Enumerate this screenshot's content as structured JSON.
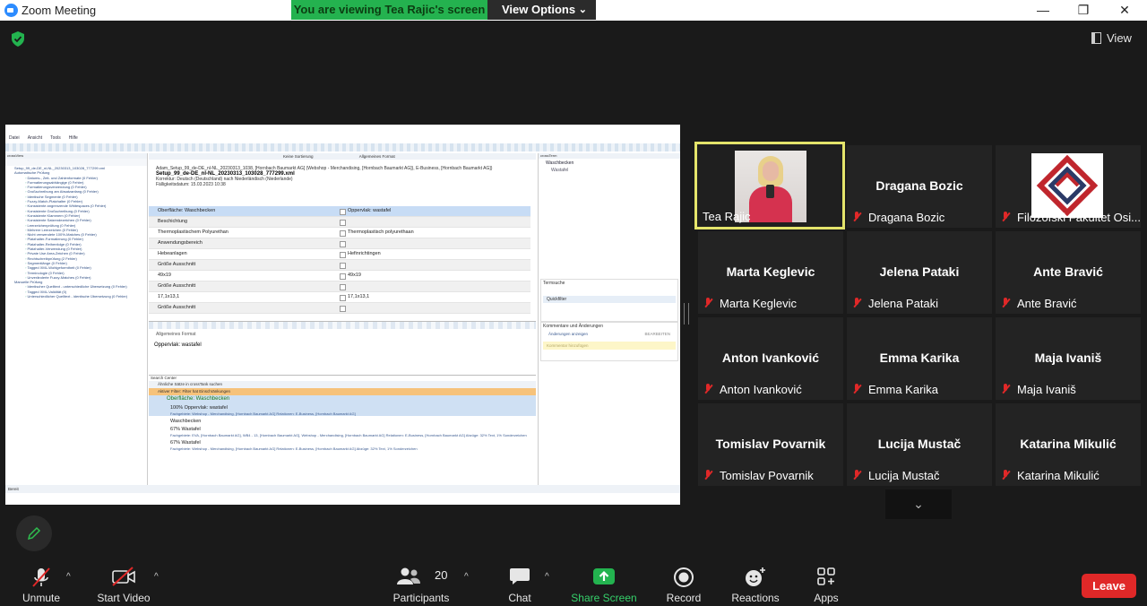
{
  "window": {
    "title": "Zoom Meeting",
    "share_banner": "You are viewing Tea Rajic's screen",
    "view_options": "View Options",
    "view_button": "View"
  },
  "shared_screen": {
    "menu": [
      "Datei",
      "Ansicht",
      "Tools",
      "Hilfe"
    ],
    "left_pane_title": "crossView",
    "tree": [
      "Setup_99_de-DE_nl-NL_20230313_103028_777299.xml",
      "Automatische Prüfung",
      "Datums-, Zeit- und Zahlenformate (0 Fehler)",
      "Formatierungsabhängige (0 Fehler)",
      "Formatierungsverwendung (0 Fehler)",
      "Großschreibung am Absatzanfang (0 Fehler)",
      "Identische Segmente (0 Fehler)",
      "Fuzzy-Match-Platzhalter (0 Fehler)",
      "Konsistente angrenzende Whitespaces (0 Fehler)",
      "Konsistente Großschreibung (0 Fehler)",
      "Konsistente Klammern (0 Fehler)",
      "Konsistente Satzendezeichen (0 Fehler)",
      "Leerzeichenprüfung (0 Fehler)",
      "Mehrere Leerzeichen (0 Fehler)",
      "Nicht verwendete 100%-Matches (0 Fehler)",
      "Platzhalter-Formatierung (0 Fehler)",
      "Platzhalter-Reihenfolge (0 Fehler)",
      "Platzhalter-Verwendung (0 Fehler)",
      "Private Use Area-Zeichen (0 Fehler)",
      "Rechtschreibprüfung (2 Fehler)",
      "Segmentlänge (0 Fehler)",
      "Tagged XML-Wohlgeformtheit (0 Fehler)",
      "Terminologie (0 Fehler)",
      "Unveränderte Fuzzy-Matches (0 Fehler)",
      "Manuelle Prüfung",
      "Identischer Quelltext - unterschiedliche Übersetzung (0 Fehler)",
      "Tagged XML-Validität (0)",
      "Unterschiedlicher Quelltext - identische Übersetzung (0 Fehler)"
    ],
    "sort_label": "Keine Sortierung",
    "format_label": "Allgemeines Format",
    "meta_line1": "Adam_Setup_99_de-DE_nl-NL_20230313_1038, [Hornbach Baumarkt AG] (Webshop - Merchandising, [Hornbach Baumarkt AG]), E-Business, [Hornbach Baumarkt AG])",
    "meta_file": "Setup_99_de-DE_nl-NL_20230313_103028_777299.xml",
    "meta_line3": "Korrektur: Deutsch (Deutschland) nach Niederländisch (Niederlande)",
    "meta_line4": "Fälligkeitsdatum: 15.03.2023 10:38",
    "segments": [
      {
        "src": "Oberfläche: Waschbecken",
        "tgt": "Oppervlak: wastafel"
      },
      {
        "src": "Beschichtung",
        "tgt": ""
      },
      {
        "src": "Thermoplastischem Polyurethan",
        "tgt": "Thermoplastisch polyurethaan"
      },
      {
        "src": "Anwendungsbereich",
        "tgt": ""
      },
      {
        "src": "Hebeanlagen",
        "tgt": "Hefinrichtingen"
      },
      {
        "src": "Größe Ausschnitt",
        "tgt": ""
      },
      {
        "src": "49x19",
        "tgt": "49x19"
      },
      {
        "src": "Größe Ausschnitt",
        "tgt": ""
      },
      {
        "src": "17,1x13,1",
        "tgt": "17,1x13,1"
      },
      {
        "src": "Größe Ausschnitt",
        "tgt": ""
      }
    ],
    "editor_format": "Allgemeines Format",
    "editor_text": "Oppervlak: wastafel",
    "search_title": "Search Center",
    "search_bar": "Ähnliche Sätze in crossTank suchen",
    "filter_text": "Aktiver Filter: Filter hat Einschränkungen",
    "search_term": "Oberfläche: Waschbecken",
    "hits": [
      {
        "pct": "100%",
        "text": "Oppervlak: wastafel",
        "meta": "Fachgebiete: Webshop - Merchandising, [Hornbach Baumarkt AG]   Relationen: E-Business, [Hornbach Baumarkt AG]"
      },
      {
        "pct": "",
        "text": "Waschbecken",
        "meta": ""
      },
      {
        "pct": "67%",
        "text": "Wastafel",
        "meta": "Fachgebiete: EVA, [Hornbach Baumarkt AG], WB4 - 13, [Hornbach Baumarkt AG], Webshop - Merchandising, [Hornbach Baumarkt AG]   Relationen: E-Business, [Hornbach Baumarkt AG]   Abzüge: 32% Text, 1% Sonderzeichen"
      },
      {
        "pct": "67%",
        "text": "Wastafel",
        "meta": "Fachgebiete: Webshop - Merchandising, [Hornbach Baumarkt AG]   Relationen: E-Business, [Hornbach Baumarkt AG]   Abzüge: 32% Text, 1% Sonderzeichen"
      }
    ],
    "right_pane_title": "crossTerm",
    "term_entries": [
      "Waschbecken",
      "Wastafel"
    ],
    "termsearch_title": "Termsuche",
    "quickfilter": "Quickfilter",
    "comments_title": "Kommentare und Änderungen",
    "changes_label": "Änderungen anzeigen",
    "edit_label": "BEARBEITEN",
    "comment_placeholder": "Kommentar hinzufügen",
    "status": "Bereit"
  },
  "participants": [
    {
      "display": "",
      "label": "Tea Rajic",
      "muted": false,
      "active": true,
      "video": "photo"
    },
    {
      "display": "Dragana Bozic",
      "label": "Dragana Bozic",
      "muted": true
    },
    {
      "display": "",
      "label": "Filozofski Fakultet Osi...",
      "muted": true,
      "video": "logo"
    },
    {
      "display": "Marta Keglevic",
      "label": "Marta Keglevic",
      "muted": true
    },
    {
      "display": "Jelena Pataki",
      "label": "Jelena Pataki",
      "muted": true
    },
    {
      "display": "Ante Bravić",
      "label": "Ante Bravić",
      "muted": true
    },
    {
      "display": "Anton Ivanković",
      "label": "Anton Ivanković",
      "muted": true
    },
    {
      "display": "Emma Karika",
      "label": "Emma Karika",
      "muted": true
    },
    {
      "display": "Maja Ivaniš",
      "label": "Maja Ivaniš",
      "muted": true
    },
    {
      "display": "Tomislav Povarnik",
      "label": "Tomislav Povarnik",
      "muted": true
    },
    {
      "display": "Lucija Mustač",
      "label": "Lucija Mustač",
      "muted": true
    },
    {
      "display": "Katarina Mikulić",
      "label": "Katarina Mikulić",
      "muted": true
    }
  ],
  "toolbar": {
    "unmute": "Unmute",
    "start_video": "Start Video",
    "participants": "Participants",
    "participants_count": "20",
    "chat": "Chat",
    "share_screen": "Share Screen",
    "record": "Record",
    "reactions": "Reactions",
    "apps": "Apps",
    "leave": "Leave"
  },
  "colors": {
    "share_green": "#24b24f",
    "active_speaker": "#e4e46b",
    "leave_red": "#e02828",
    "muted_red": "#e02828"
  }
}
